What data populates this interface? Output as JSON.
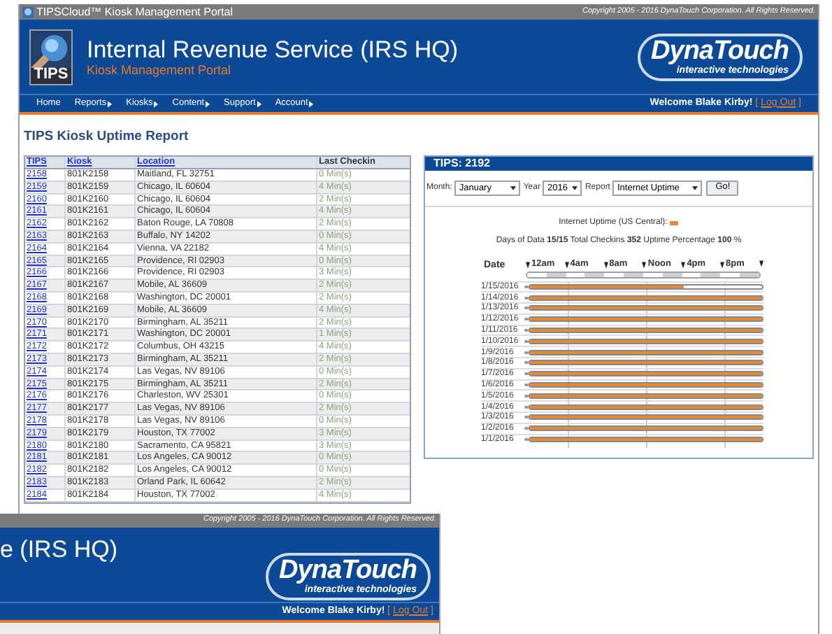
{
  "window": {
    "title": "TIPSCloud™ Kiosk Management Portal",
    "copyright": "Copyright 2005 - 2016 DynaTouch Corporation. All Rights Reserved."
  },
  "header": {
    "logo_text": "TIPS",
    "title": "Internal Revenue Service (IRS HQ)",
    "subtitle": "Kiosk Management Portal",
    "brand": "DynaTouch",
    "brand_tagline": "interactive technologies"
  },
  "nav": {
    "items": [
      {
        "label": "Home",
        "submenu": false
      },
      {
        "label": "Reports",
        "submenu": true
      },
      {
        "label": "Kiosks",
        "submenu": true
      },
      {
        "label": "Content",
        "submenu": true
      },
      {
        "label": "Support",
        "submenu": true
      },
      {
        "label": "Account",
        "submenu": true
      }
    ],
    "welcome": "Welcome Blake Kirby!",
    "logout_open": "[",
    "logout": "Log Out",
    "logout_close": "]"
  },
  "page_title": "TIPS Kiosk Uptime Report",
  "table": {
    "columns": [
      {
        "label": "TIPS",
        "sortable": true
      },
      {
        "label": "Kiosk",
        "sortable": true
      },
      {
        "label": "Location",
        "sortable": true
      },
      {
        "label": "Last Checkin",
        "sortable": false
      }
    ],
    "rows": [
      [
        "2158",
        "801K2158",
        "Maitland, FL 32751",
        "0 Min(s)"
      ],
      [
        "2159",
        "801K2159",
        "Chicago, IL 60604",
        "4 Min(s)"
      ],
      [
        "2160",
        "801K2160",
        "Chicago, IL 60604",
        "2 Min(s)"
      ],
      [
        "2161",
        "801K2161",
        "Chicago, IL 60604",
        "4 Min(s)"
      ],
      [
        "2162",
        "801K2162",
        "Baton Rouge, LA 70808",
        "2 Min(s)"
      ],
      [
        "2163",
        "801K2163",
        "Buffalo, NY 14202",
        "0 Min(s)"
      ],
      [
        "2164",
        "801K2164",
        "Vienna, VA 22182",
        "4 Min(s)"
      ],
      [
        "2165",
        "801K2165",
        "Providence, RI 02903",
        "0 Min(s)"
      ],
      [
        "2166",
        "801K2166",
        "Providence, RI 02903",
        "3 Min(s)"
      ],
      [
        "2167",
        "801K2167",
        "Mobile, AL 36609",
        "2 Min(s)"
      ],
      [
        "2168",
        "801K2168",
        "Washington, DC 20001",
        "2 Min(s)"
      ],
      [
        "2169",
        "801K2169",
        "Mobile, AL 36609",
        "4 Min(s)"
      ],
      [
        "2170",
        "801K2170",
        "Birmingham, AL 35211",
        "2 Min(s)"
      ],
      [
        "2171",
        "801K2171",
        "Washington, DC 20001",
        "1 Min(s)"
      ],
      [
        "2172",
        "801K2172",
        "Columbus, OH 43215",
        "4 Min(s)"
      ],
      [
        "2173",
        "801K2173",
        "Birmingham, AL 35211",
        "2 Min(s)"
      ],
      [
        "2174",
        "801K2174",
        "Las Vegas, NV 89106",
        "0 Min(s)"
      ],
      [
        "2175",
        "801K2175",
        "Birmingham, AL 35211",
        "2 Min(s)"
      ],
      [
        "2176",
        "801K2176",
        "Charleston, WV 25301",
        "0 Min(s)"
      ],
      [
        "2177",
        "801K2177",
        "Las Vegas, NV 89106",
        "2 Min(s)"
      ],
      [
        "2178",
        "801K2178",
        "Las Vegas, NV 89106",
        "0 Min(s)"
      ],
      [
        "2179",
        "801K2179",
        "Houston, TX 77002",
        "3 Min(s)"
      ],
      [
        "2180",
        "801K2180",
        "Sacramento, CA 95821",
        "3 Min(s)"
      ],
      [
        "2181",
        "801K2181",
        "Los Angeles, CA 90012",
        "0 Min(s)"
      ],
      [
        "2182",
        "801K2182",
        "Los Angeles, CA 90012",
        "0 Min(s)"
      ],
      [
        "2183",
        "801K2183",
        "Orland Park, IL 60642",
        "2 Min(s)"
      ],
      [
        "2184",
        "801K2184",
        "Houston, TX 77002",
        "4 Min(s)"
      ]
    ]
  },
  "panel": {
    "title": "TIPS: 2192",
    "filters": [
      {
        "label": "Month:",
        "value": "January"
      },
      {
        "label": "Year",
        "value": "2016"
      },
      {
        "label": "Report",
        "value": "Internet Uptime"
      }
    ],
    "go_button": "Go!",
    "legend": "Internet Uptime (US Central):",
    "summary": "Days of Data **15/15** Total Checkins **352** Uptime Percentage **100** %",
    "date_header": "Date",
    "ticks": [
      "12am",
      "4am",
      "8am",
      "Noon",
      "4pm",
      "8pm"
    ],
    "days": [
      {
        "date": "1/15/2016",
        "level": 0.66
      },
      {
        "date": "1/14/2016",
        "level": 1
      },
      {
        "date": "1/13/2016",
        "level": 1
      },
      {
        "date": "1/12/2016",
        "level": 1
      },
      {
        "date": "1/11/2016",
        "level": 1
      },
      {
        "date": "1/10/2016",
        "level": 1
      },
      {
        "date": "1/9/2016",
        "level": 1
      },
      {
        "date": "1/8/2016",
        "level": 1
      },
      {
        "date": "1/7/2016",
        "level": 1
      },
      {
        "date": "1/6/2016",
        "level": 1
      },
      {
        "date": "1/5/2016",
        "level": 1
      },
      {
        "date": "1/4/2016",
        "level": 1
      },
      {
        "date": "1/3/2016",
        "level": 1
      },
      {
        "date": "1/2/2016",
        "level": 1
      },
      {
        "date": "1/1/2016",
        "level": 1
      }
    ]
  },
  "overlay_window": {
    "copyright": "Copyright 2005 - 2016 DynaTouch Corporation. All Rights Reserved.",
    "title_fragment": "e (IRS HQ)",
    "brand": "DynaTouch",
    "brand_tagline": "interactive technologies",
    "welcome": "Welcome Blake Kirby!",
    "logout_open": "[",
    "logout": "Log Out",
    "logout_close": "]"
  }
}
